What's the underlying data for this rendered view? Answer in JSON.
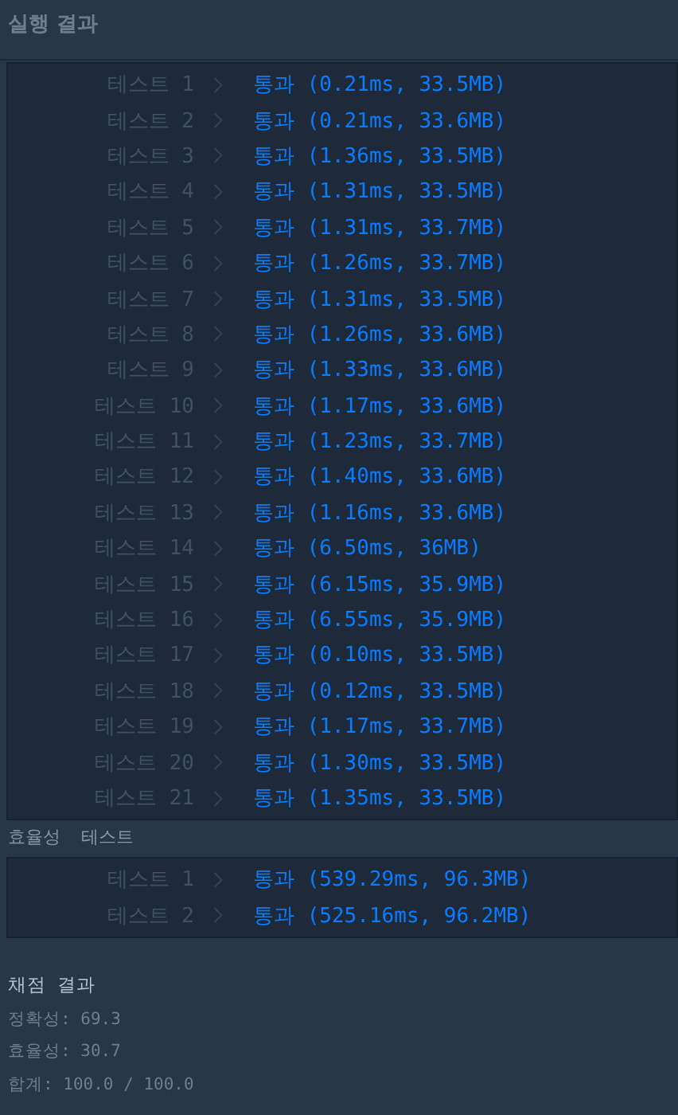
{
  "header": {
    "title": "실행 결과"
  },
  "accuracy_tests": [
    {
      "label": "테스트 1",
      "passed": true,
      "result": "통과 (0.21ms, 33.5MB)"
    },
    {
      "label": "테스트 2",
      "passed": true,
      "result": "통과 (0.21ms, 33.6MB)"
    },
    {
      "label": "테스트 3",
      "passed": true,
      "result": "통과 (1.36ms, 33.5MB)"
    },
    {
      "label": "테스트 4",
      "passed": true,
      "result": "통과 (1.31ms, 33.5MB)"
    },
    {
      "label": "테스트 5",
      "passed": true,
      "result": "통과 (1.31ms, 33.7MB)"
    },
    {
      "label": "테스트 6",
      "passed": true,
      "result": "통과 (1.26ms, 33.7MB)"
    },
    {
      "label": "테스트 7",
      "passed": true,
      "result": "통과 (1.31ms, 33.5MB)"
    },
    {
      "label": "테스트 8",
      "passed": true,
      "result": "통과 (1.26ms, 33.6MB)"
    },
    {
      "label": "테스트 9",
      "passed": true,
      "result": "통과 (1.33ms, 33.6MB)"
    },
    {
      "label": "테스트 10",
      "passed": true,
      "result": "통과 (1.17ms, 33.6MB)"
    },
    {
      "label": "테스트 11",
      "passed": true,
      "result": "통과 (1.23ms, 33.7MB)"
    },
    {
      "label": "테스트 12",
      "passed": true,
      "result": "통과 (1.40ms, 33.6MB)"
    },
    {
      "label": "테스트 13",
      "passed": true,
      "result": "통과 (1.16ms, 33.6MB)"
    },
    {
      "label": "테스트 14",
      "passed": true,
      "result": "통과 (6.50ms, 36MB)"
    },
    {
      "label": "테스트 15",
      "passed": true,
      "result": "통과 (6.15ms, 35.9MB)"
    },
    {
      "label": "테스트 16",
      "passed": true,
      "result": "통과 (6.55ms, 35.9MB)"
    },
    {
      "label": "테스트 17",
      "passed": true,
      "result": "통과 (0.10ms, 33.5MB)"
    },
    {
      "label": "테스트 18",
      "passed": true,
      "result": "통과 (0.12ms, 33.5MB)"
    },
    {
      "label": "테스트 19",
      "passed": true,
      "result": "통과 (1.17ms, 33.7MB)"
    },
    {
      "label": "테스트 20",
      "passed": true,
      "result": "통과 (1.30ms, 33.5MB)"
    },
    {
      "label": "테스트 21",
      "passed": true,
      "result": "통과 (1.35ms, 33.5MB)"
    }
  ],
  "efficiency_heading": "효율성  테스트",
  "efficiency_tests": [
    {
      "label": "테스트 1",
      "passed": true,
      "result": "통과 (539.29ms, 96.3MB)"
    },
    {
      "label": "테스트 2",
      "passed": true,
      "result": "통과 (525.16ms, 96.2MB)"
    }
  ],
  "grading": {
    "title": "채점 결과",
    "lines": [
      "정확성: 69.3",
      "효율성: 30.7",
      "합계: 100.0 / 100.0"
    ]
  }
}
